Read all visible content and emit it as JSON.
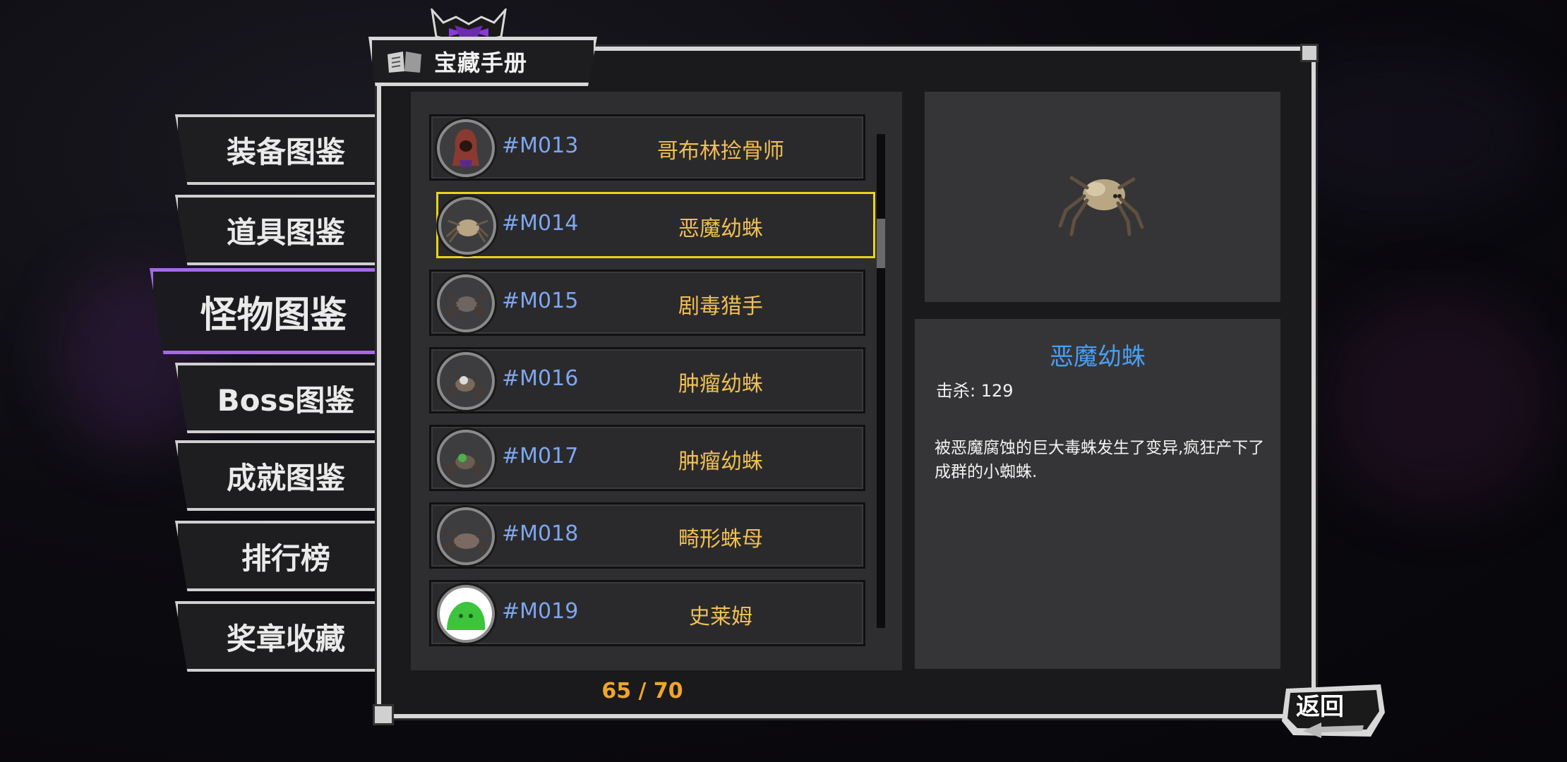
{
  "window": {
    "title": "宝藏手册"
  },
  "menu": {
    "items": [
      {
        "label": "装备图鉴"
      },
      {
        "label": "道具图鉴"
      },
      {
        "label": "怪物图鉴",
        "active": true
      },
      {
        "label": "Boss图鉴"
      },
      {
        "label": "成就图鉴"
      },
      {
        "label": "排行榜"
      },
      {
        "label": "奖章收藏"
      }
    ]
  },
  "list": {
    "rows": [
      {
        "id": "#M013",
        "name": "哥布林捡骨师",
        "icon": "hooded-goblin-icon"
      },
      {
        "id": "#M014",
        "name": "恶魔幼蛛",
        "icon": "demon-spiderling-icon",
        "selected": true
      },
      {
        "id": "#M015",
        "name": "剧毒猎手",
        "icon": "venom-hunter-spider-icon"
      },
      {
        "id": "#M016",
        "name": "肿瘤幼蛛",
        "icon": "tumor-spiderling-icon"
      },
      {
        "id": "#M017",
        "name": "肿瘤幼蛛",
        "icon": "green-tumor-spiderling-icon"
      },
      {
        "id": "#M018",
        "name": "畸形蛛母",
        "icon": "deformed-spider-mother-icon"
      },
      {
        "id": "#M019",
        "name": "史莱姆",
        "icon": "green-slime-icon"
      }
    ],
    "counter": "65 / 70"
  },
  "detail": {
    "name": "恶魔幼蛛",
    "kills": "击杀: 129",
    "description": "被恶魔腐蚀的巨大毒蛛发生了变异,疯狂产下了成群的小蜘蛛."
  },
  "back": {
    "label": "返回"
  },
  "colors": {
    "active_menu_border": "#a569e8",
    "selected_row_border": "#e6d619",
    "id_text": "#7fa6ee",
    "name_text": "#f0bf52",
    "detail_title": "#4a9ef2",
    "counter_text": "#f0a52a"
  }
}
